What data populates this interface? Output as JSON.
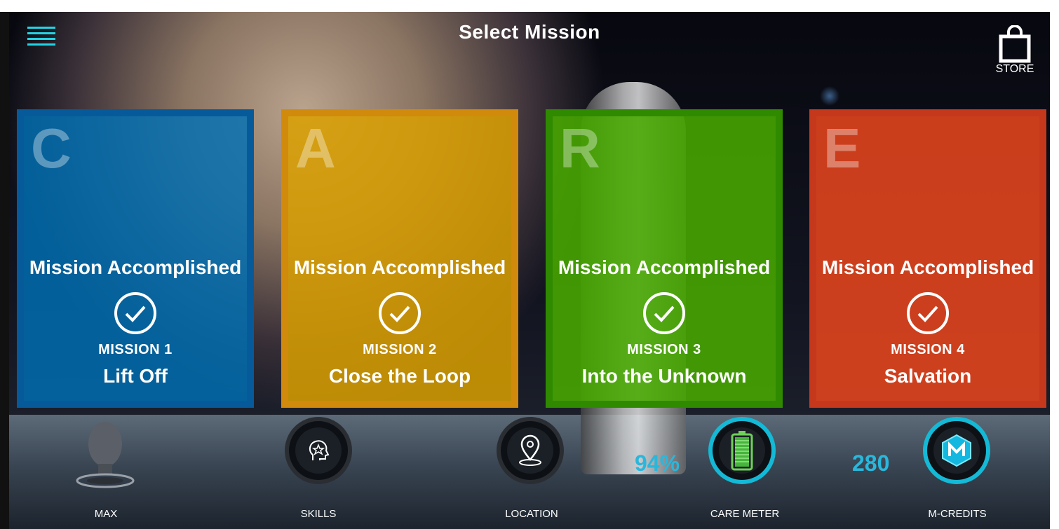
{
  "header": {
    "title": "Select Mission",
    "store_label": "STORE"
  },
  "missions": [
    {
      "letter": "C",
      "status": "Mission Accomplished",
      "number": "MISSION 1",
      "name": "Lift Off",
      "color": "#0070b4"
    },
    {
      "letter": "A",
      "status": "Mission Accomplished",
      "number": "MISSION 2",
      "name": "Close the Loop",
      "color": "#daa000"
    },
    {
      "letter": "R",
      "status": "Mission Accomplished",
      "number": "MISSION 3",
      "name": "Into the Unknown",
      "color": "#48aa00"
    },
    {
      "letter": "E",
      "status": "Mission Accomplished",
      "number": "MISSION 4",
      "name": "Salvation",
      "color": "#e6461e"
    }
  ],
  "nav": {
    "max_label": "MAX",
    "skills_label": "SKILLS",
    "location_label": "LOCATION",
    "care_label": "CARE METER",
    "care_value": "94%",
    "credits_label": "M-CREDITS",
    "credits_value": "280"
  },
  "colors": {
    "accent": "#21d5e6"
  },
  "icons": [
    "menu-icon",
    "shopping-bag-icon",
    "checkmark-icon",
    "head-icon",
    "skills-icon",
    "location-pin-icon",
    "battery-icon",
    "m-credits-icon"
  ]
}
